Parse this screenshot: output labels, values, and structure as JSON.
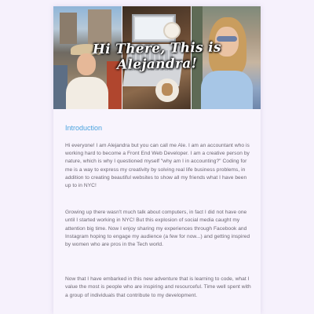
{
  "hero": {
    "title": "Hi There, This is Alejandra!"
  },
  "intro": {
    "heading": "Introduction",
    "paragraphs": [
      "Hi everyone! I am Alejandra but you can call me Ale. I am an accountant who is working hard to become a Front End Web Developer. I am a creative person by nature, which is why I questioned myself \"why am I in accounting?\" Coding for me is a way to express my creativity by solving real life business problems, in addition to creating beautiful websites to show all my friends what I have been up to in NYC!",
      "Growing up there wasn't much talk about computers, in fact I did not have one until I started working in NYC! But this explosion of social media caught my attention big time. Now I enjoy sharing my experiences through Facebook and Instagram hoping to engage my audience (a few for now...) and getting inspired by women who are pros in the Tech world.",
      "Now that I have embarked in this new adventure that is learning to code, what I value the most is people who are inspiring and resourceful. Time well spent with a group of individuals that contribute to my development."
    ]
  },
  "colors": {
    "accent": "#4aa3df",
    "background": "#f6f1fc",
    "text": "#6a6570"
  }
}
